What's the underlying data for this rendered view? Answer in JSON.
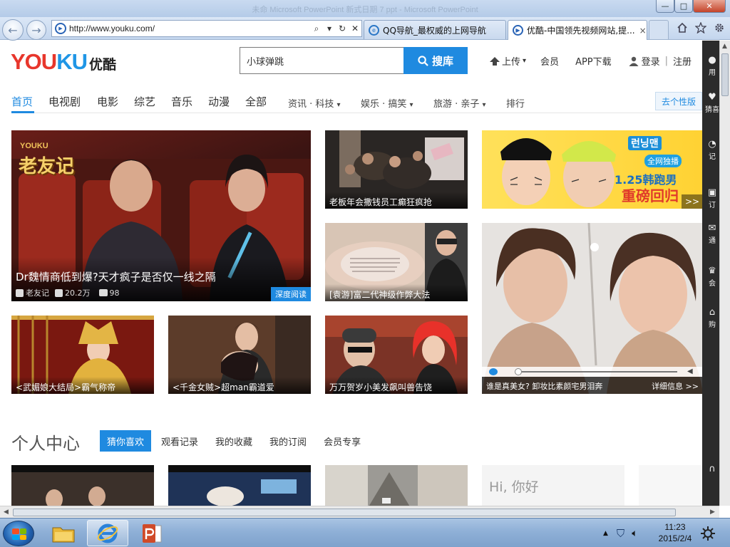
{
  "browser": {
    "window_title_ghost": "未命 Microsoft PowerPoint 新式日期 7 ppt - Microsoft PowerPoint",
    "address": "http://www.youku.com/",
    "tabs": [
      {
        "title": "QQ导航_最权威的上网导航",
        "favicon": "ie-e-icon"
      },
      {
        "title": "优酷-中国领先视频网站,提...",
        "favicon": "youku-play-icon",
        "close": "×"
      }
    ],
    "controls": {
      "search": "⌕",
      "dropdown": "▾",
      "refresh": "↻",
      "stop": "✕"
    },
    "window_buttons": {
      "minimize": "—",
      "maximize": "□",
      "close": "✕"
    }
  },
  "site": {
    "logo_en_a": "YOU",
    "logo_en_b": "KU",
    "logo_cn": "优酷",
    "search_value": "小球弹跳",
    "search_button": "搜库",
    "upload": "上传",
    "member": "会员",
    "app": "APP下载",
    "login": "登录",
    "sep": "|",
    "register": "注册"
  },
  "nav": {
    "items": [
      "首页",
      "电视剧",
      "电影",
      "综艺",
      "音乐",
      "动漫",
      "全部"
    ],
    "sub": [
      "资讯 · 科技",
      "娱乐 · 搞笑",
      "旅游 · 亲子"
    ],
    "rank": "排行",
    "personalize": "去个性版",
    "dropdown_glyph": "▾"
  },
  "feature": {
    "show_logo_small": "YOUKU",
    "show_logo": "老友记",
    "title": "Dr魏情商低到爆?天才疯子是否仅一线之隔",
    "channel": "老友记",
    "views": "20.2万",
    "comments": "98",
    "badge": "深度阅读"
  },
  "tiles": {
    "boss": "老板年会撒钱员工癫狂疯抢",
    "nail": "[袁游]富二代神级作弊大法",
    "empress": "<武媚娘大结局>霸气称帝",
    "qianjin": "<千金女贼>超man霸道爱",
    "wanwan": "万万贺岁小美发飙叫兽告饶",
    "runningman_kr": "런닝맨",
    "runningman_tag": "全网独播",
    "runningman_line1": "1.25韩跑男",
    "runningman_line2": "重磅回归",
    "more": ">>",
    "makeup_caption": "谁是真美女? 卸妆比素颜宅男泪奔",
    "makeup_detail": "详细信息 >>"
  },
  "personal": {
    "title": "个人中心",
    "tabs": [
      "猜你喜欢",
      "观看记录",
      "我的收藏",
      "我的订阅",
      "会员专享"
    ],
    "hello": "Hi, 你好"
  },
  "sidebar": [
    "用",
    "猜喜",
    "记",
    "订",
    "通",
    "会",
    "购"
  ],
  "taskbar": {
    "time": "11:23",
    "date": "2015/2/4"
  },
  "colors": {
    "accent": "#1f8ae0",
    "logo_red": "#e8362c",
    "logo_blue": "#1f96e6"
  }
}
